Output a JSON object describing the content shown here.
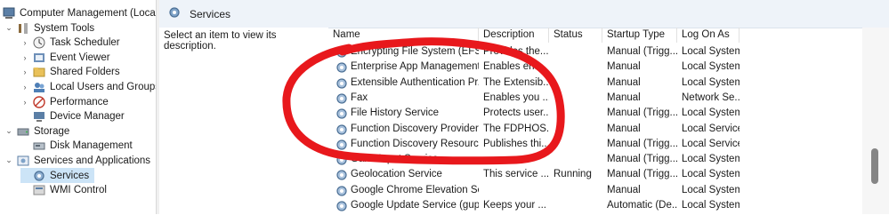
{
  "tree": {
    "root": "Computer Management (Local)",
    "items": [
      {
        "label": "System Tools",
        "icon": "tools-icon",
        "level": 1,
        "chev": "⌄"
      },
      {
        "label": "Task Scheduler",
        "icon": "clock-icon",
        "level": 2,
        "chev": "›"
      },
      {
        "label": "Event Viewer",
        "icon": "event-viewer-icon",
        "level": 2,
        "chev": "›"
      },
      {
        "label": "Shared Folders",
        "icon": "shared-folder-icon",
        "level": 2,
        "chev": "›"
      },
      {
        "label": "Local Users and Groups",
        "icon": "users-icon",
        "level": 2,
        "chev": "›"
      },
      {
        "label": "Performance",
        "icon": "performance-icon",
        "level": 2,
        "chev": "›"
      },
      {
        "label": "Device Manager",
        "icon": "device-manager-icon",
        "level": 2,
        "chev": ""
      },
      {
        "label": "Storage",
        "icon": "storage-icon",
        "level": 1,
        "chev": "⌄"
      },
      {
        "label": "Disk Management",
        "icon": "disk-icon",
        "level": 2,
        "chev": ""
      },
      {
        "label": "Services and Applications",
        "icon": "services-apps-icon",
        "level": 1,
        "chev": "⌄"
      },
      {
        "label": "Services",
        "icon": "gear-icon",
        "level": 2,
        "chev": "",
        "selected": true
      },
      {
        "label": "WMI Control",
        "icon": "wmi-icon",
        "level": 2,
        "chev": ""
      }
    ]
  },
  "header": {
    "title": "Services"
  },
  "description_panel": {
    "text": "Select an item to view its description."
  },
  "columns": [
    "Name",
    "Description",
    "Status",
    "Startup Type",
    "Log On As"
  ],
  "rows": [
    {
      "name": "Encrypting File System (EFS)",
      "description": "Provides the...",
      "status": "",
      "startup": "Manual (Trigg...",
      "logon": "Local System"
    },
    {
      "name": "Enterprise App Management...",
      "description": "Enables ent...",
      "status": "",
      "startup": "Manual",
      "logon": "Local System"
    },
    {
      "name": "Extensible Authentication Pr...",
      "description": "The Extensib...",
      "status": "",
      "startup": "Manual",
      "logon": "Local System"
    },
    {
      "name": "Fax",
      "description": "Enables you ...",
      "status": "",
      "startup": "Manual",
      "logon": "Network Se..."
    },
    {
      "name": "File History Service",
      "description": "Protects user...",
      "status": "",
      "startup": "Manual (Trigg...",
      "logon": "Local System"
    },
    {
      "name": "Function Discovery Provider ...",
      "description": "The FDPHOS...",
      "status": "",
      "startup": "Manual",
      "logon": "Local Service"
    },
    {
      "name": "Function Discovery Resourc...",
      "description": "Publishes thi...",
      "status": "",
      "startup": "Manual (Trigg...",
      "logon": "Local Service"
    },
    {
      "name": "GameInput Service",
      "description": "",
      "status": "",
      "startup": "Manual (Trigg...",
      "logon": "Local System"
    },
    {
      "name": "Geolocation Service",
      "description": "This service ...",
      "status": "Running",
      "startup": "Manual (Trigg...",
      "logon": "Local System"
    },
    {
      "name": "Google Chrome Elevation Se...",
      "description": "",
      "status": "",
      "startup": "Manual",
      "logon": "Local System"
    },
    {
      "name": "Google Update Service (gup...",
      "description": "Keeps your ...",
      "status": "",
      "startup": "Automatic (De...",
      "logon": "Local System"
    }
  ],
  "colors": {
    "annotation": "#e8181c",
    "selection": "#cce4f7",
    "header_bg": "#eef3f9"
  }
}
